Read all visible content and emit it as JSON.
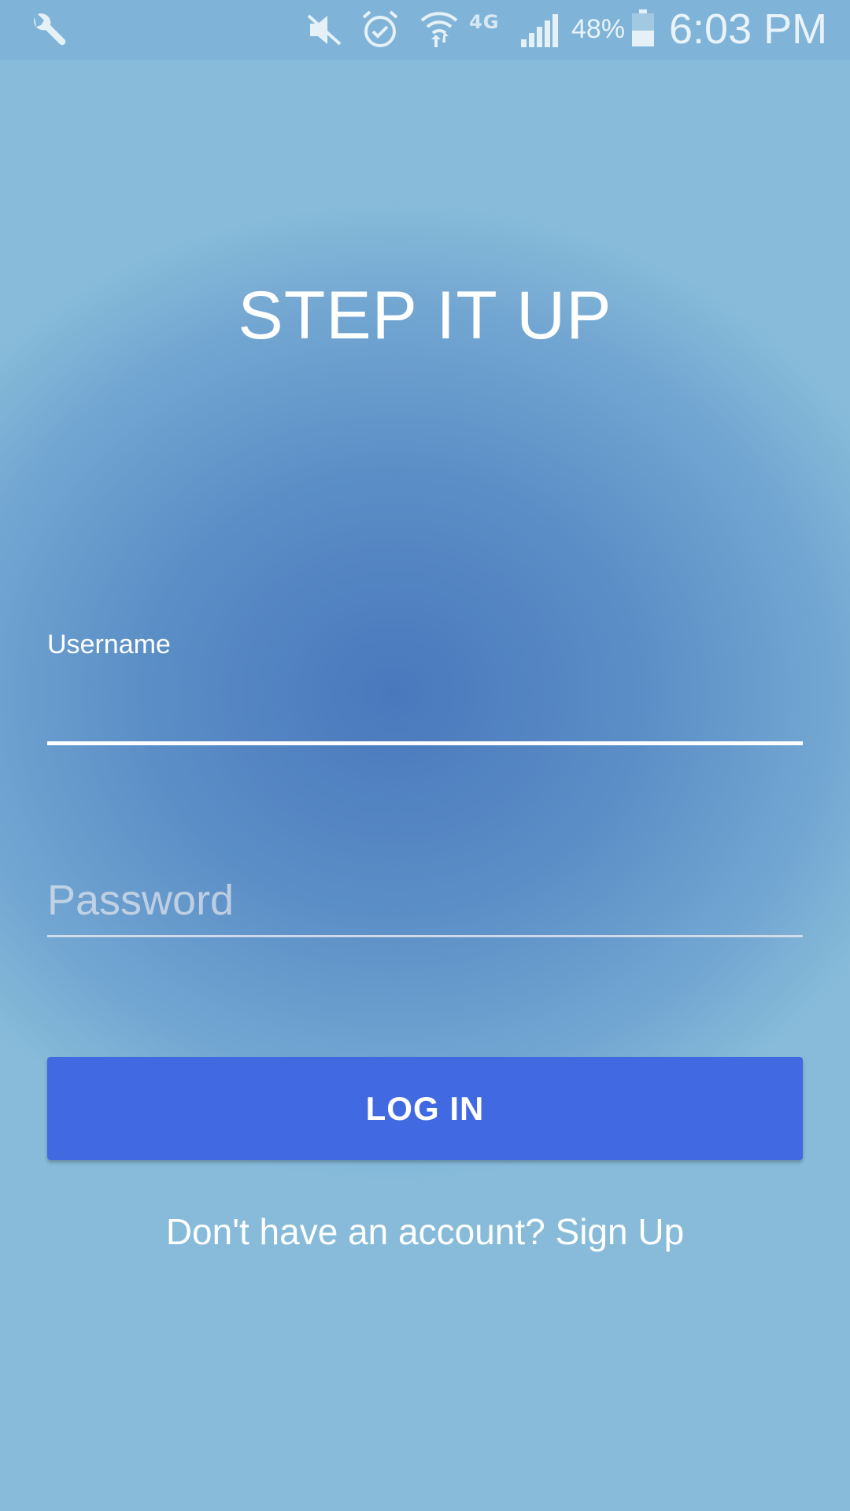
{
  "status_bar": {
    "icons": [
      "wrench-icon",
      "mute-icon",
      "alarm-icon",
      "wifi-icon",
      "network-type-icon",
      "signal-icon",
      "battery-icon"
    ],
    "network_type": "4G",
    "battery_percent": "48%",
    "battery_level": 0.48,
    "time": "6:03 PM"
  },
  "app": {
    "title": "STEP IT UP"
  },
  "login_form": {
    "username_label": "Username",
    "username_value": "",
    "password_placeholder": "Password",
    "password_value": "",
    "login_button_label": "LOG IN",
    "signup_prompt": "Don't have an account? Sign Up"
  },
  "colors": {
    "button": "#4169e1",
    "background_center": "#4a78bd",
    "background_edge": "#87bbd9",
    "text": "#ffffff"
  }
}
